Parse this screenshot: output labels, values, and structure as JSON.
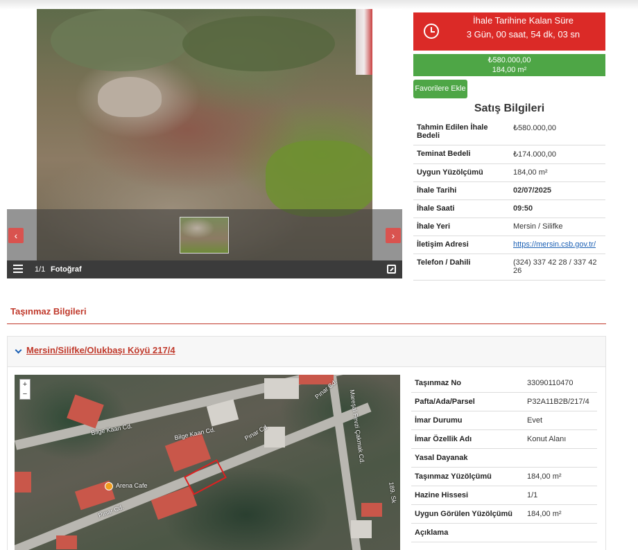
{
  "gallery": {
    "counter": "1/1",
    "label": "Fotoğraf",
    "prev": "‹",
    "next": "›"
  },
  "countdown": {
    "title": "İhale Tarihine Kalan Süre",
    "remaining": "3 Gün, 00 saat, 54 dk, 03 sn"
  },
  "price": {
    "amount": "₺580.000,00",
    "area": "184,00 m²"
  },
  "favorite_button": "Favorilere Ekle",
  "sale_info": {
    "title": "Satış Bilgileri",
    "rows": [
      {
        "key": "Tahmin Edilen İhale Bedeli",
        "value": "₺580.000,00"
      },
      {
        "key": "Teminat Bedeli",
        "value": "₺174.000,00"
      },
      {
        "key": "Uygun Yüzölçümü",
        "value": "184,00 m²"
      },
      {
        "key": "İhale Tarihi",
        "value": "02/07/2025"
      },
      {
        "key": "İhale Saati",
        "value": "09:50"
      },
      {
        "key": "İhale Yeri",
        "value": "Mersin / Silifke"
      },
      {
        "key": "İletişim Adresi",
        "value": "https://mersin.csb.gov.tr/"
      },
      {
        "key": "Telefon / Dahili",
        "value": "(324) 337 42 28 / 337 42 26"
      }
    ]
  },
  "section_title": "Taşınmaz Bilgileri",
  "property": {
    "link": "Mersin/Silifke/Olukbaşı Köyü 217/4",
    "map": {
      "zoom_in": "+",
      "zoom_out": "−",
      "streets": [
        "Bilge Kaan Cd.",
        "Bilge Kaan Cd.",
        "Pınar Cd.",
        "Pınar Cd.",
        "Pınar Cd.",
        "Mareşal Fevzi Çakmak Cd.",
        "189. Sk"
      ],
      "poi": "Arena Cafe"
    },
    "rows": [
      {
        "key": "Taşınmaz No",
        "value": "33090110470"
      },
      {
        "key": "Pafta/Ada/Parsel",
        "value": "P32A11B2B/217/4"
      },
      {
        "key": "İmar Durumu",
        "value": "Evet"
      },
      {
        "key": "İmar Özellik Adı",
        "value": "Konut Alanı"
      },
      {
        "key": "Yasal Dayanak",
        "value": ""
      },
      {
        "key": "Taşınmaz Yüzölçümü",
        "value": "184,00 m²"
      },
      {
        "key": "Hazine Hissesi",
        "value": "1/1"
      },
      {
        "key": "Uygun Görülen Yüzölçümü",
        "value": "184,00 m²"
      },
      {
        "key": "Açıklama",
        "value": ""
      }
    ]
  },
  "colors": {
    "countdown": "#db2a27",
    "price": "#4ea646",
    "accent": "#c0392b",
    "link": "#1a5fb4"
  }
}
